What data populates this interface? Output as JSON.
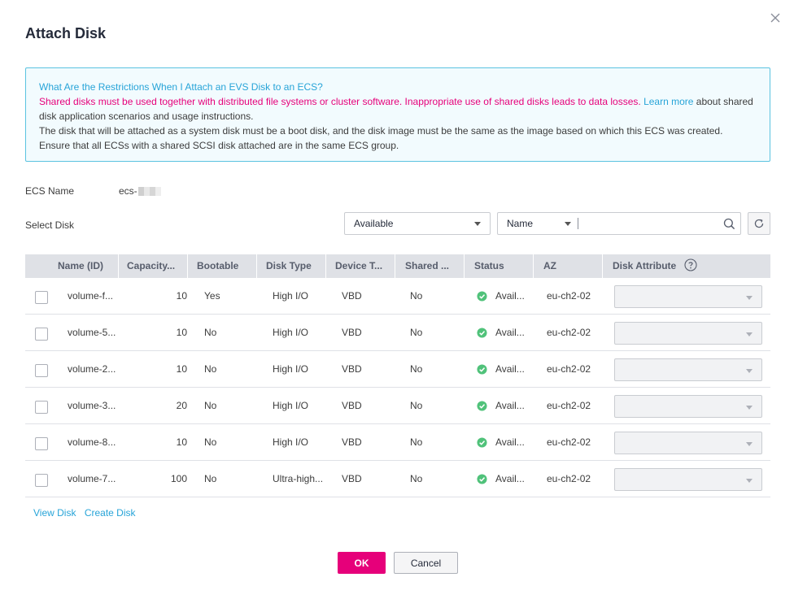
{
  "dialog": {
    "title": "Attach Disk"
  },
  "notice": {
    "question": "What Are the Restrictions When I Attach an EVS Disk to an ECS?",
    "warning": "Shared disks must be used together with distributed file systems or cluster software. Inappropriate use of shared disks leads to data losses.",
    "learn_more": "Learn more",
    "after_link": "about shared disk application scenarios and usage instructions.",
    "line_boot": "The disk that will be attached as a system disk must be a boot disk, and the disk image must be the same as the image based on which this ECS was created.",
    "line_scsi": "Ensure that all ECSs with a shared SCSI disk attached are in the same ECS group."
  },
  "ecs": {
    "label": "ECS Name",
    "value": "ecs-"
  },
  "select_disk": {
    "label": "Select Disk",
    "status_filter": "Available",
    "search_field": "Name",
    "search_value": ""
  },
  "table": {
    "headers": {
      "name": "Name (ID)",
      "capacity": "Capacity...",
      "bootable": "Bootable",
      "disk_type": "Disk Type",
      "device_type": "Device T...",
      "shared": "Shared ...",
      "status": "Status",
      "az": "AZ",
      "disk_attribute": "Disk Attribute"
    },
    "rows": [
      {
        "name": "volume-f...",
        "capacity": "10",
        "bootable": "Yes",
        "disk_type": "High I/O",
        "device_type": "VBD",
        "shared": "No",
        "status": "Avail...",
        "az": "eu-ch2-02",
        "attribute": ""
      },
      {
        "name": "volume-5...",
        "capacity": "10",
        "bootable": "No",
        "disk_type": "High I/O",
        "device_type": "VBD",
        "shared": "No",
        "status": "Avail...",
        "az": "eu-ch2-02",
        "attribute": ""
      },
      {
        "name": "volume-2...",
        "capacity": "10",
        "bootable": "No",
        "disk_type": "High I/O",
        "device_type": "VBD",
        "shared": "No",
        "status": "Avail...",
        "az": "eu-ch2-02",
        "attribute": ""
      },
      {
        "name": "volume-3...",
        "capacity": "20",
        "bootable": "No",
        "disk_type": "High I/O",
        "device_type": "VBD",
        "shared": "No",
        "status": "Avail...",
        "az": "eu-ch2-02",
        "attribute": ""
      },
      {
        "name": "volume-8...",
        "capacity": "10",
        "bootable": "No",
        "disk_type": "High I/O",
        "device_type": "VBD",
        "shared": "No",
        "status": "Avail...",
        "az": "eu-ch2-02",
        "attribute": ""
      },
      {
        "name": "volume-7...",
        "capacity": "100",
        "bootable": "No",
        "disk_type": "Ultra-high...",
        "device_type": "VBD",
        "shared": "No",
        "status": "Avail...",
        "az": "eu-ch2-02",
        "attribute": ""
      }
    ]
  },
  "links": {
    "view_disk": "View Disk",
    "create_disk": "Create Disk"
  },
  "buttons": {
    "ok": "OK",
    "cancel": "Cancel"
  },
  "colors": {
    "primary": "#e6007a",
    "link": "#27a4d8",
    "status_ok": "#50c27a",
    "notice_border": "#5bc3e0",
    "notice_bg": "#f2fbfe"
  },
  "icons": {
    "close": "close-icon",
    "search": "search-icon",
    "refresh": "refresh-icon",
    "help": "help-icon",
    "status": "check-circle-icon"
  }
}
